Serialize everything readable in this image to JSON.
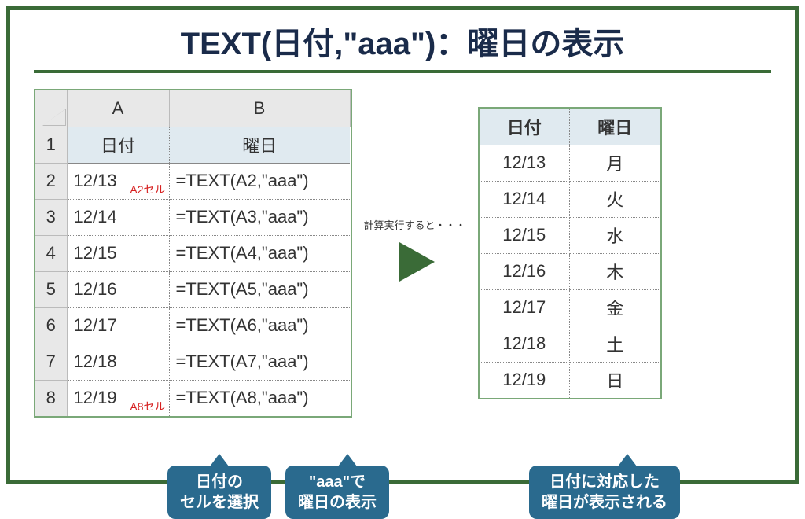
{
  "title": "TEXT(日付,\"aaa\")：曜日の表示",
  "left": {
    "colA": "A",
    "colB": "B",
    "headerDate": "日付",
    "headerDay": "曜日",
    "rows": [
      {
        "n": "1"
      },
      {
        "n": "2",
        "date": "12/13",
        "formula": "=TEXT(A2,\"aaa\")",
        "annot": "A2セル"
      },
      {
        "n": "3",
        "date": "12/14",
        "formula": "=TEXT(A3,\"aaa\")"
      },
      {
        "n": "4",
        "date": "12/15",
        "formula": "=TEXT(A4,\"aaa\")"
      },
      {
        "n": "5",
        "date": "12/16",
        "formula": "=TEXT(A5,\"aaa\")"
      },
      {
        "n": "6",
        "date": "12/17",
        "formula": "=TEXT(A6,\"aaa\")"
      },
      {
        "n": "7",
        "date": "12/18",
        "formula": "=TEXT(A7,\"aaa\")"
      },
      {
        "n": "8",
        "date": "12/19",
        "formula": "=TEXT(A8,\"aaa\")",
        "annot": "A8セル"
      }
    ]
  },
  "arrow_label": "計算実行すると・・・",
  "right": {
    "headerDate": "日付",
    "headerDay": "曜日",
    "rows": [
      {
        "date": "12/13",
        "day": "月"
      },
      {
        "date": "12/14",
        "day": "火"
      },
      {
        "date": "12/15",
        "day": "水"
      },
      {
        "date": "12/16",
        "day": "木"
      },
      {
        "date": "12/17",
        "day": "金"
      },
      {
        "date": "12/18",
        "day": "土"
      },
      {
        "date": "12/19",
        "day": "日"
      }
    ]
  },
  "callouts": {
    "c1_l1": "日付の",
    "c1_l2": "セルを選択",
    "c2_l1": "\"aaa\"で",
    "c2_l2": "曜日の表示",
    "c3_l1": "日付に対応した",
    "c3_l2": "曜日が表示される"
  }
}
